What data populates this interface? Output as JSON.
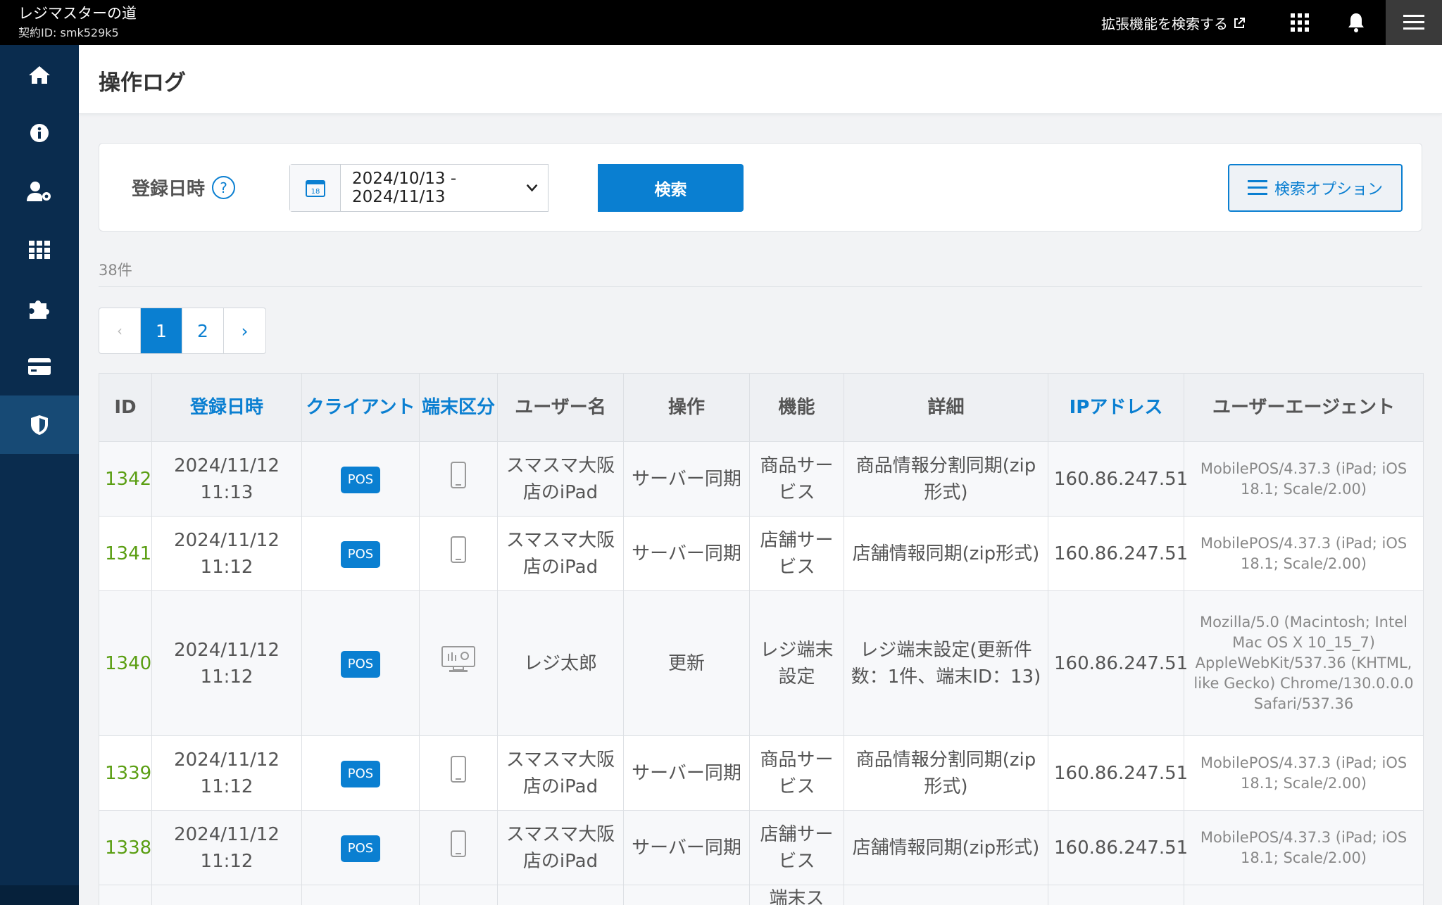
{
  "topbar": {
    "app_title": "レジマスターの道",
    "contract_id": "契約ID: smk529k5",
    "extension_search": "拡張機能を検索する"
  },
  "header": {
    "title": "操作ログ"
  },
  "filter": {
    "label": "登録日時",
    "date_range": "2024/10/13 - 2024/11/13",
    "calendar_day": "18",
    "search_button": "検索",
    "options_button": "検索オプション"
  },
  "result_count": "38件",
  "pagination": {
    "prev": "‹",
    "pages": [
      "1",
      "2"
    ],
    "next": "›",
    "current": "1"
  },
  "table": {
    "columns": [
      "ID",
      "登録日時",
      "クライアント",
      "端末区分",
      "ユーザー名",
      "操作",
      "機能",
      "詳細",
      "IPアドレス",
      "ユーザーエージェント"
    ],
    "rows": [
      {
        "id": "1342",
        "date": "2024/11/12",
        "time": "11:13",
        "client": "POS",
        "device": "mobile",
        "user": "スマスマ大阪店のiPad",
        "operation": "サーバー同期",
        "feature": "商品サービス",
        "detail": "商品情報分割同期(zip形式)",
        "ip": "160.86.247.51",
        "ua": "MobilePOS/4.37.3 (iPad; iOS 18.1; Scale/2.00)"
      },
      {
        "id": "1341",
        "date": "2024/11/12",
        "time": "11:12",
        "client": "POS",
        "device": "mobile",
        "user": "スマスマ大阪店のiPad",
        "operation": "サーバー同期",
        "feature": "店舗サービス",
        "detail": "店舗情報同期(zip形式)",
        "ip": "160.86.247.51",
        "ua": "MobilePOS/4.37.3 (iPad; iOS 18.1; Scale/2.00)"
      },
      {
        "id": "1340",
        "date": "2024/11/12",
        "time": "11:12",
        "client": "POS",
        "device": "desktop",
        "user": "レジ太郎",
        "operation": "更新",
        "feature": "レジ端末設定",
        "detail": "レジ端末設定(更新件数：1件、端末ID：13)",
        "ip": "160.86.247.51",
        "ua": "Mozilla/5.0 (Macintosh; Intel Mac OS X 10_15_7) AppleWebKit/537.36 (KHTML, like Gecko) Chrome/130.0.0.0 Safari/537.36"
      },
      {
        "id": "1339",
        "date": "2024/11/12",
        "time": "11:12",
        "client": "POS",
        "device": "mobile",
        "user": "スマスマ大阪店のiPad",
        "operation": "サーバー同期",
        "feature": "商品サービス",
        "detail": "商品情報分割同期(zip形式)",
        "ip": "160.86.247.51",
        "ua": "MobilePOS/4.37.3 (iPad; iOS 18.1; Scale/2.00)"
      },
      {
        "id": "1338",
        "date": "2024/11/12",
        "time": "11:12",
        "client": "POS",
        "device": "mobile",
        "user": "スマスマ大阪店のiPad",
        "operation": "サーバー同期",
        "feature": "店舗サービス",
        "detail": "店舗情報同期(zip形式)",
        "ip": "160.86.247.51",
        "ua": "MobilePOS/4.37.3 (iPad; iOS 18.1; Scale/2.00)"
      }
    ],
    "partial_row_feature": "端末ス"
  },
  "sidebar": {
    "items": [
      "home-icon",
      "info-icon",
      "user-settings-icon",
      "apps-grid-icon",
      "puzzle-icon",
      "credit-card-icon",
      "shield-icon"
    ],
    "active": "shield-icon"
  },
  "colors": {
    "primary": "#0a7fd1",
    "sidebar": "#0a2c4e",
    "id_link": "#5a9e12"
  }
}
